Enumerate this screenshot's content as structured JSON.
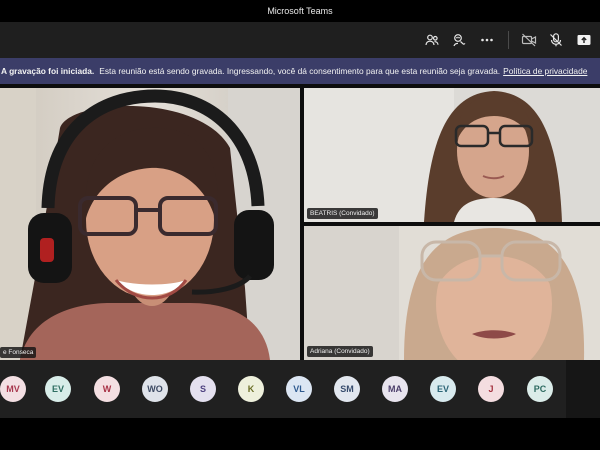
{
  "window": {
    "title": "Microsoft Teams"
  },
  "toolbar": {
    "icons": [
      "people-icon",
      "raise-hand-icon",
      "more-icon",
      "camera-off-icon",
      "mic-off-icon",
      "share-icon"
    ]
  },
  "banner": {
    "lead": "A gravação foi iniciada.",
    "message": "Esta reunião está sendo gravada. Ingressando, você dá consentimento para que esta reunião seja gravada.",
    "link": "Política de privacidade"
  },
  "participants": {
    "main": {
      "name": "e Fonseca"
    },
    "top_right": {
      "name": "BEATRIS (Convidado)"
    },
    "bottom_right": {
      "name": "Adriana (Convidado)"
    }
  },
  "tray": {
    "avatars": [
      {
        "initials": "MV",
        "bg": "#f3dfe3",
        "fg": "#a8384f"
      },
      {
        "initials": "EV",
        "bg": "#d8ede9",
        "fg": "#2e6e62"
      },
      {
        "initials": "W",
        "bg": "#f4dfe2",
        "fg": "#a83246"
      },
      {
        "initials": "WO",
        "bg": "#dfe3ea",
        "fg": "#3d4a63"
      },
      {
        "initials": "S",
        "bg": "#e4e0ef",
        "fg": "#4e4180"
      },
      {
        "initials": "K",
        "bg": "#eef0dc",
        "fg": "#6b6e26"
      },
      {
        "initials": "VL",
        "bg": "#dce6f3",
        "fg": "#2f5a8f"
      },
      {
        "initials": "SM",
        "bg": "#e2e7ef",
        "fg": "#384d6e"
      },
      {
        "initials": "MA",
        "bg": "#e8e4ee",
        "fg": "#4c3e6b"
      },
      {
        "initials": "EV",
        "bg": "#d8eaee",
        "fg": "#2b6475"
      },
      {
        "initials": "J",
        "bg": "#f4dde0",
        "fg": "#a3303e"
      },
      {
        "initials": "PC",
        "bg": "#dbece9",
        "fg": "#2d6a60"
      }
    ]
  }
}
